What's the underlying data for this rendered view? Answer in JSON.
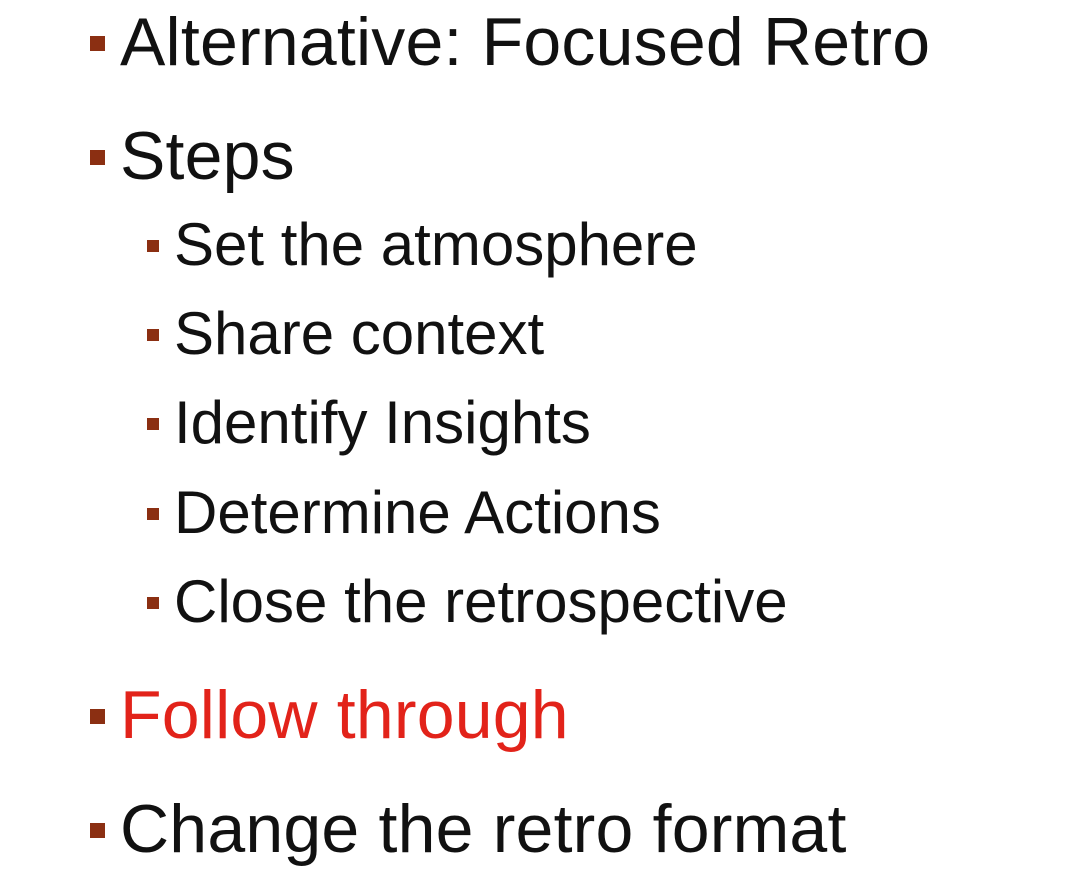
{
  "slide": {
    "items": [
      {
        "level": 1,
        "text": "Alternative: Focused Retro"
      },
      {
        "level": 1,
        "text": "Steps"
      },
      {
        "level": 2,
        "text": "Set the atmosphere"
      },
      {
        "level": 2,
        "text": "Share context"
      },
      {
        "level": 2,
        "text": "Identify Insights"
      },
      {
        "level": 2,
        "text": "Determine Actions"
      },
      {
        "level": 2,
        "text": "Close the retrospective"
      },
      {
        "level": 1,
        "text": "Follow through",
        "highlighted": true
      },
      {
        "level": 1,
        "text": "Change the retro format"
      }
    ]
  },
  "colors": {
    "bullet": "#8b2f12",
    "text": "#111111",
    "highlight": "#e2231a",
    "background": "#ffffff"
  }
}
